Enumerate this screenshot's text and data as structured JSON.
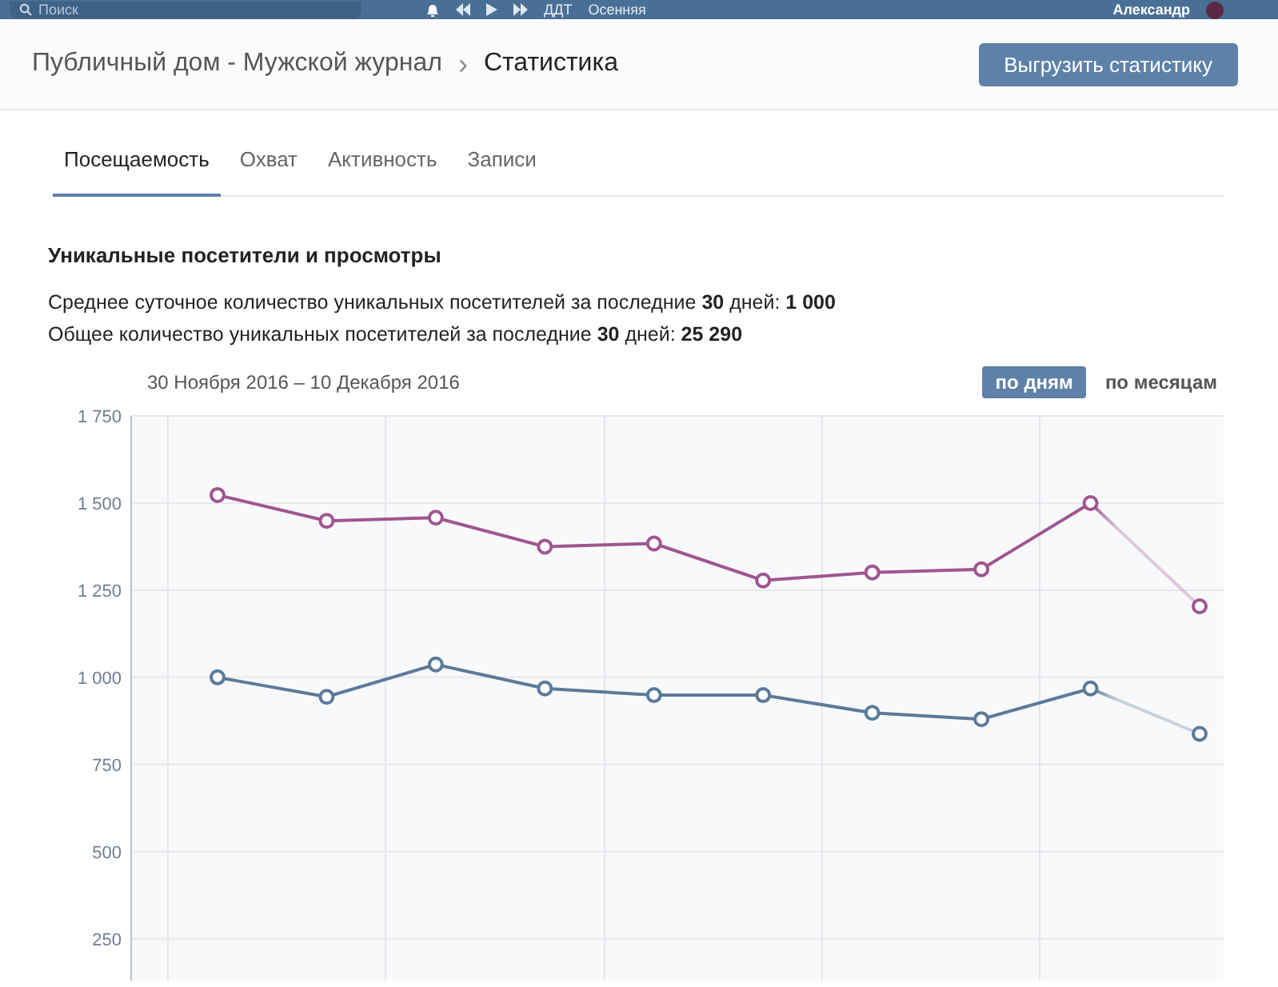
{
  "top_bar": {
    "search": {
      "placeholder": "Поиск"
    },
    "player": {
      "artist": "ДДТ",
      "track": "Осенняя"
    },
    "user": {
      "name": "Александр"
    }
  },
  "breadcrumb": {
    "parent": "Публичный дом - Мужской журнал",
    "separator": "›",
    "current": "Статистика"
  },
  "export_button": "Выгрузить статистику",
  "tabs": [
    {
      "label": "Посещаемость",
      "selected": true
    },
    {
      "label": "Охват",
      "selected": false
    },
    {
      "label": "Активность",
      "selected": false
    },
    {
      "label": "Записи",
      "selected": false
    }
  ],
  "section": {
    "title": "Уникальные посетители и просмотры",
    "stats": [
      "Среднее суточное количество уникальных посетителей за последние **30** дней: **1 000**",
      "Общее количество уникальных посетителей за последние **30** дней: **25 290**"
    ],
    "date_range": "30 Ноября 2016 – 10 Декабря 2016",
    "period_toggle": [
      {
        "label": "по дням",
        "selected": true
      },
      {
        "label": "по месяцам",
        "selected": false
      }
    ],
    "chart_data": {
      "type": "line",
      "categories": [
        null,
        null,
        null,
        null,
        null,
        null,
        null,
        null,
        null,
        null
      ],
      "ylim": [
        130,
        1750
      ],
      "grid": true,
      "yticks": [
        {
          "value": 250,
          "label": "250"
        },
        {
          "value": 500,
          "label": "500"
        },
        {
          "value": 750,
          "label": "750"
        },
        {
          "value": 1000,
          "label": "1 000"
        },
        {
          "value": 1250,
          "label": "1 250"
        },
        {
          "value": 1500,
          "label": "1 500"
        },
        {
          "value": 1750,
          "label": "1 750"
        }
      ],
      "series": [
        {
          "color": "#a0558f",
          "marker": "circle",
          "values": [
            1523,
            1449,
            1458,
            1375,
            1384,
            1278,
            1301,
            1310,
            1500,
            1204
          ]
        },
        {
          "color": "#5b7a99",
          "marker": "circle",
          "values": [
            1000,
            944,
            1037,
            968,
            949,
            949,
            898,
            880,
            968,
            838
          ]
        }
      ]
    }
  }
}
